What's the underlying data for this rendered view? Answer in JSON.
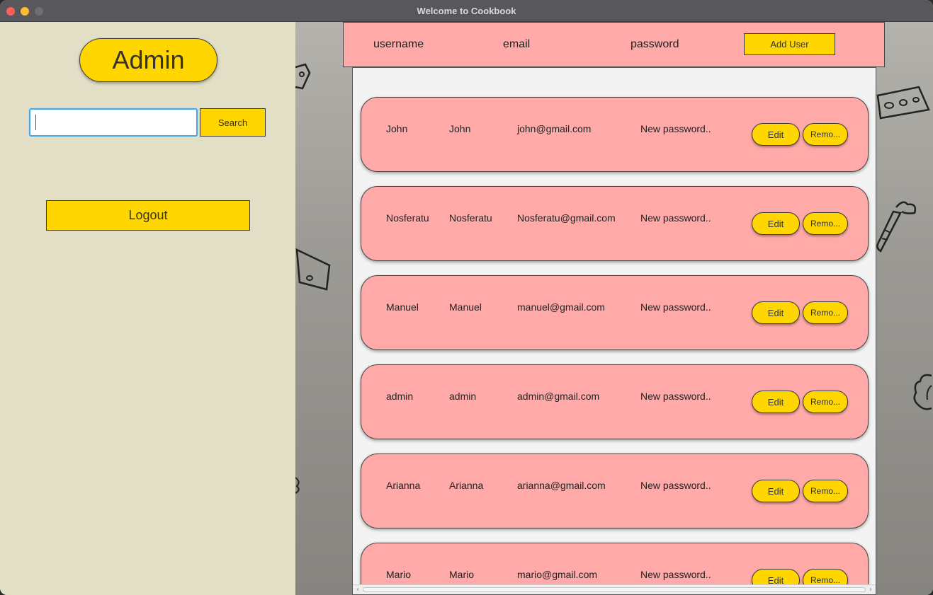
{
  "window": {
    "title": "Welcome to Cookbook"
  },
  "sidebar": {
    "badge": "Admin",
    "search": {
      "value": "",
      "placeholder": "",
      "button": "Search"
    },
    "logout": "Logout"
  },
  "header": {
    "columns": [
      "username",
      "email",
      "password"
    ],
    "add_button": "Add User"
  },
  "users": [
    {
      "name": "John",
      "username": "John",
      "email": "john@gmail.com",
      "password": "New password..",
      "edit": "Edit",
      "remove": "Remo..."
    },
    {
      "name": "Nosferatu",
      "username": "Nosferatu",
      "email": "Nosferatu@gmail.com",
      "password": "New password..",
      "edit": "Edit",
      "remove": "Remo..."
    },
    {
      "name": "Manuel",
      "username": "Manuel",
      "email": "manuel@gmail.com",
      "password": "New password..",
      "edit": "Edit",
      "remove": "Remo..."
    },
    {
      "name": "admin",
      "username": "admin",
      "email": "admin@gmail.com",
      "password": "New password..",
      "edit": "Edit",
      "remove": "Remo..."
    },
    {
      "name": "Arianna",
      "username": "Arianna",
      "email": "arianna@gmail.com",
      "password": "New password..",
      "edit": "Edit",
      "remove": "Remo..."
    },
    {
      "name": "Mario",
      "username": "Mario",
      "email": "mario@gmail.com",
      "password": "New password..",
      "edit": "Edit",
      "remove": "Remo..."
    }
  ],
  "colors": {
    "accent": "#ffd600",
    "card": "#ffaaa8",
    "sidebar": "#e3dfc7",
    "titlebar": "#58585c"
  },
  "icons": [
    "cheese-doodle-icon",
    "carrot-doodle-icon",
    "lettuce-doodle-icon"
  ]
}
